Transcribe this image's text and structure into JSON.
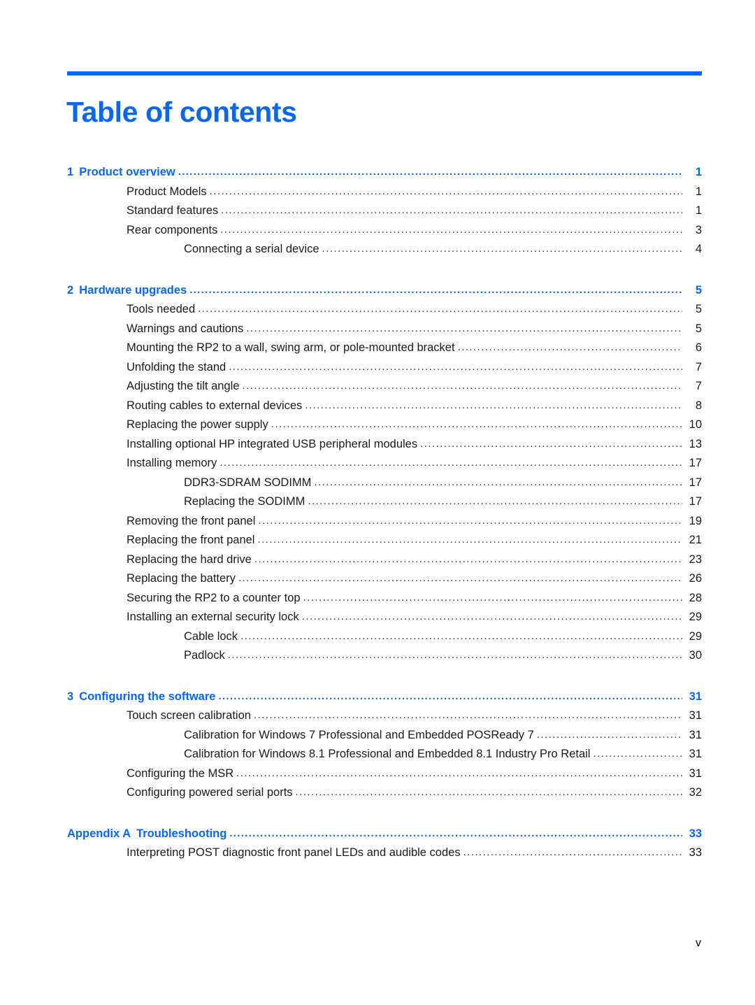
{
  "document": {
    "title": "Table of contents",
    "footer_page_label": "v",
    "accent_color": "#0866f0",
    "text_color": "#1a1a1a",
    "leader_char": "."
  },
  "toc": {
    "sections": [
      {
        "chapter": {
          "number": "1",
          "label": "Product overview",
          "page": "1",
          "level": "chapter"
        },
        "entries": [
          {
            "label": "Product Models",
            "page": "1",
            "level": 1
          },
          {
            "label": "Standard features",
            "page": "1",
            "level": 1
          },
          {
            "label": "Rear components",
            "page": "3",
            "level": 1
          },
          {
            "label": "Connecting a serial device",
            "page": "4",
            "level": 2
          }
        ]
      },
      {
        "chapter": {
          "number": "2",
          "label": "Hardware upgrades",
          "page": "5",
          "level": "chapter"
        },
        "entries": [
          {
            "label": "Tools needed",
            "page": "5",
            "level": 1
          },
          {
            "label": "Warnings and cautions",
            "page": "5",
            "level": 1
          },
          {
            "label": "Mounting the RP2 to a wall, swing arm, or pole-mounted bracket",
            "page": "6",
            "level": 1
          },
          {
            "label": "Unfolding the stand",
            "page": "7",
            "level": 1
          },
          {
            "label": "Adjusting the tilt angle",
            "page": "7",
            "level": 1
          },
          {
            "label": "Routing cables to external devices",
            "page": "8",
            "level": 1
          },
          {
            "label": "Replacing the power supply",
            "page": "10",
            "level": 1
          },
          {
            "label": "Installing optional HP integrated USB peripheral modules",
            "page": "13",
            "level": 1
          },
          {
            "label": "Installing memory",
            "page": "17",
            "level": 1
          },
          {
            "label": "DDR3-SDRAM SODIMM",
            "page": "17",
            "level": 2
          },
          {
            "label": "Replacing the SODIMM",
            "page": "17",
            "level": 2
          },
          {
            "label": "Removing the front panel",
            "page": "19",
            "level": 1
          },
          {
            "label": "Replacing the front panel",
            "page": "21",
            "level": 1
          },
          {
            "label": "Replacing the hard drive",
            "page": "23",
            "level": 1
          },
          {
            "label": "Replacing the battery",
            "page": "26",
            "level": 1
          },
          {
            "label": "Securing the RP2 to a counter top",
            "page": "28",
            "level": 1
          },
          {
            "label": "Installing an external security lock",
            "page": "29",
            "level": 1
          },
          {
            "label": "Cable lock",
            "page": "29",
            "level": 2
          },
          {
            "label": "Padlock",
            "page": "30",
            "level": 2
          }
        ]
      },
      {
        "chapter": {
          "number": "3",
          "label": "Configuring the software",
          "page": "31",
          "level": "chapter"
        },
        "entries": [
          {
            "label": "Touch screen calibration",
            "page": "31",
            "level": 1
          },
          {
            "label": "Calibration for Windows 7 Professional and Embedded POSReady 7",
            "page": "31",
            "level": 2
          },
          {
            "label": "Calibration for Windows 8.1 Professional and Embedded 8.1 Industry Pro Retail",
            "page": "31",
            "level": 2
          },
          {
            "label": "Configuring the MSR",
            "page": "31",
            "level": 1
          },
          {
            "label": "Configuring powered serial ports",
            "page": "32",
            "level": 1
          }
        ]
      },
      {
        "chapter": {
          "number": "Appendix A",
          "label": "Troubleshooting",
          "page": "33",
          "level": "chapter"
        },
        "entries": [
          {
            "label": "Interpreting POST diagnostic front panel LEDs and audible codes",
            "page": "33",
            "level": 1
          }
        ]
      }
    ]
  }
}
